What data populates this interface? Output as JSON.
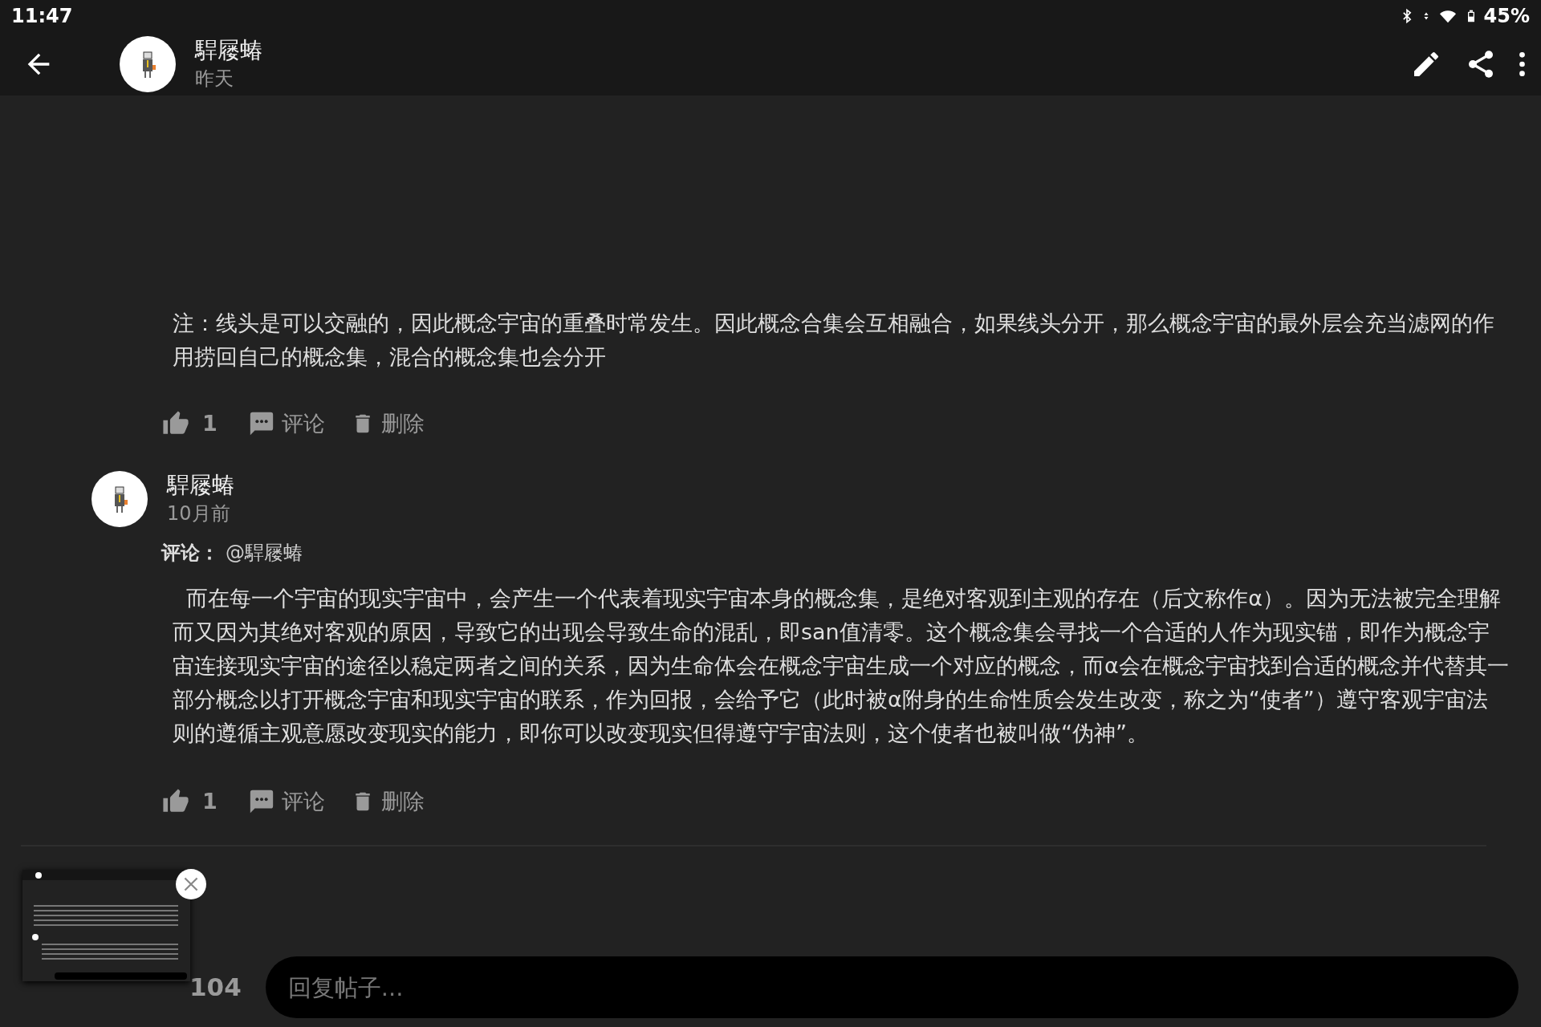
{
  "status_bar": {
    "time": "11:47",
    "battery": "45%"
  },
  "header": {
    "author": "駻屦蝽",
    "time": "昨天"
  },
  "post": {
    "text": "注：线头是可以交融的，因此概念宇宙的重叠时常发生。因此概念合集会互相融合，如果线头分开，那么概念宇宙的最外层会充当滤网的作用捞回自己的概念集，混合的概念集也会分开",
    "likes": "1",
    "comment_label": "评论",
    "delete_label": "删除"
  },
  "comments": [
    {
      "author": "駻屦蝽",
      "time": "10月前",
      "reply_label": "评论：",
      "reply_to": "@駻屦蝽",
      "text": "  而在每一个宇宙的现实宇宙中，会产生一个代表着现实宇宙本身的概念集，是绝对客观到主观的存在（后文称作α）。因为无法被完全理解而又因为其绝对客观的原因，导致它的出现会导致生命的混乱，即san值清零。这个概念集会寻找一个合适的人作为现实锚，即作为概念宇宙连接现实宇宙的途径以稳定两者之间的关系，因为生命体会在概念宇宙生成一个对应的概念，而α会在概念宇宙找到合适的概念并代替其一部分概念以打开概念宇宙和现实宇宙的联系，作为回报，会给予它（此时被α附身的生命性质会发生改变，称之为“使者”）遵守客观宇宙法则的遵循主观意愿改变现实的能力，即你可以改变现实但得遵守宇宙法则，这个使者也被叫做“伪神”。",
      "likes": "1",
      "comment_label": "评论",
      "delete_label": "删除"
    }
  ],
  "bottom_bar": {
    "favorites": "104",
    "reply": {
      "placeholder": "回复帖子..."
    }
  }
}
